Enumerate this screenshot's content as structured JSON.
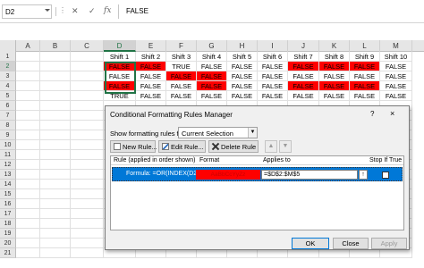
{
  "formula_bar": {
    "name_box": "D2",
    "formula": "FALSE",
    "cancel_icon": "close-icon",
    "enter_icon": "check-icon",
    "fx_label": "fx"
  },
  "grid": {
    "columns": [
      "A",
      "B",
      "C",
      "D",
      "E",
      "F",
      "G",
      "H",
      "I",
      "J",
      "K",
      "L",
      "M"
    ],
    "active_column": "D",
    "rows": [
      "1",
      "2",
      "3",
      "4",
      "5",
      "6",
      "7",
      "8",
      "9",
      "10",
      "11",
      "12",
      "13",
      "14",
      "15",
      "16",
      "17",
      "18",
      "19",
      "20",
      "21"
    ],
    "active_row": "2",
    "headers": [
      "Shift 1",
      "Shift 2",
      "Shift 3",
      "Shift 4",
      "Shift 5",
      "Shift 6",
      "Shift 7",
      "Shift 8",
      "Shift 9",
      "Shift 10"
    ],
    "data": [
      [
        "FALSE",
        "FALSE",
        "TRUE",
        "FALSE",
        "FALSE",
        "FALSE",
        "FALSE",
        "FALSE",
        "FALSE",
        "FALSE"
      ],
      [
        "FALSE",
        "FALSE",
        "FALSE",
        "FALSE",
        "FALSE",
        "FALSE",
        "FALSE",
        "FALSE",
        "FALSE",
        "FALSE"
      ],
      [
        "FALSE",
        "FALSE",
        "FALSE",
        "FALSE",
        "FALSE",
        "FALSE",
        "FALSE",
        "FALSE",
        "FALSE",
        "FALSE"
      ],
      [
        "TRUE",
        "FALSE",
        "FALSE",
        "FALSE",
        "FALSE",
        "FALSE",
        "FALSE",
        "FALSE",
        "FALSE",
        "FALSE"
      ]
    ],
    "highlight_color": "#ff0000"
  },
  "dialog": {
    "title": "Conditional Formatting Rules Manager",
    "help_label": "?",
    "close_label": "×",
    "show_label": "Show formatting rules for:",
    "show_value": "Current Selection",
    "new_rule": "New Rule...",
    "edit_rule": "Edit Rule...",
    "delete_rule": "Delete Rule",
    "move_up": "▲",
    "move_down": "▼",
    "columns": {
      "rule": "Rule (applied in order shown)",
      "format": "Format",
      "applies_to": "Applies to",
      "stop_if_true": "Stop If True"
    },
    "rule": {
      "formula": "Formula: =OR(INDEX(D2...",
      "format_preview": "AaBbCcYyZz",
      "applies_to": "=$D$2:$M$5",
      "collapse_icon": "↑"
    },
    "ok": "OK",
    "close": "Close",
    "apply": "Apply"
  }
}
